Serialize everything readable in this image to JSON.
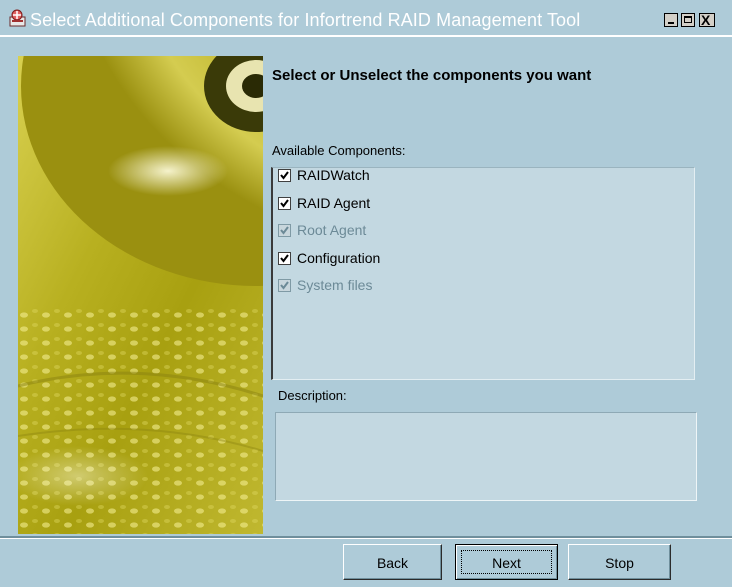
{
  "window": {
    "title": "Select Additional Components for Infortrend RAID Management Tool",
    "app_icon": "installer-icon",
    "controls": [
      "minimize-icon",
      "maximize-icon",
      "close-icon"
    ],
    "close_glyph": "X"
  },
  "main": {
    "heading": "Select or Unselect the components you want",
    "available_label": "Available Components:",
    "components": [
      {
        "label": "RAIDWatch",
        "checked": true,
        "enabled": true
      },
      {
        "label": "RAID Agent",
        "checked": true,
        "enabled": true
      },
      {
        "label": "Root Agent",
        "checked": true,
        "enabled": false
      },
      {
        "label": "Configuration",
        "checked": true,
        "enabled": true
      },
      {
        "label": "System files",
        "checked": true,
        "enabled": false
      }
    ],
    "description_label": "Description:",
    "description_text": ""
  },
  "footer": {
    "back_label": "Back",
    "next_label": "Next",
    "stop_label": "Stop"
  },
  "colors": {
    "panel_bg": "#aecbd8",
    "list_bg": "#c3d8e1",
    "disabled_text": "#6c8a97",
    "banner_gold": "#c8c020"
  }
}
